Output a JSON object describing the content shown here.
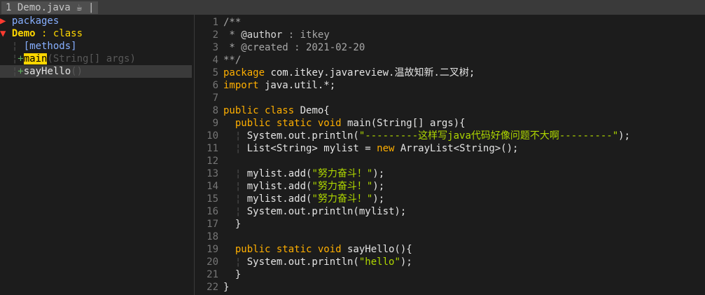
{
  "tabline": {
    "tab_label": "1 Demo.java ☕ |"
  },
  "tagbar": {
    "packages_label": "packages",
    "class_name": "Demo",
    "class_kind": " : class",
    "methods_group": "[methods]",
    "methods": [
      {
        "name": "main",
        "signature": "(String[] args)"
      },
      {
        "name": "sayHello",
        "signature": "()"
      }
    ]
  },
  "editor": {
    "lines": [
      {
        "n": "1",
        "tokens": [
          [
            "c-com",
            "/**"
          ]
        ]
      },
      {
        "n": "2",
        "tokens": [
          [
            "c-com",
            " * "
          ],
          [
            "c-ann",
            "@author"
          ],
          [
            "c-com",
            " : itkey"
          ]
        ]
      },
      {
        "n": "3",
        "tokens": [
          [
            "c-com",
            " * @created : 2021-02-20"
          ]
        ]
      },
      {
        "n": "4",
        "tokens": [
          [
            "c-com",
            "**/"
          ]
        ]
      },
      {
        "n": "5",
        "tokens": [
          [
            "c-kw",
            "package"
          ],
          [
            "c-txt",
            " com.itkey.javareview.温故知新.二叉树;"
          ]
        ]
      },
      {
        "n": "6",
        "tokens": [
          [
            "c-kw",
            "import"
          ],
          [
            "c-txt",
            " java.util.*;"
          ]
        ]
      },
      {
        "n": "7",
        "tokens": []
      },
      {
        "n": "8",
        "tokens": [
          [
            "c-kw",
            "public class"
          ],
          [
            "c-txt",
            " Demo{"
          ]
        ]
      },
      {
        "n": "9",
        "tokens": [
          [
            "c-txt",
            "  "
          ],
          [
            "c-kw",
            "public static void"
          ],
          [
            "c-txt",
            " main(String[] args){"
          ]
        ]
      },
      {
        "n": "10",
        "tokens": [
          [
            "vg",
            "  ¦ "
          ],
          [
            "c-txt",
            "System.out.println("
          ],
          [
            "c-str",
            "\"---------这样写java代码好像问题不大啊---------\""
          ],
          [
            "c-txt",
            ");"
          ]
        ]
      },
      {
        "n": "11",
        "tokens": [
          [
            "vg",
            "  ¦ "
          ],
          [
            "c-txt",
            "List<String> mylist = "
          ],
          [
            "c-kw",
            "new"
          ],
          [
            "c-txt",
            " ArrayList<String>();"
          ]
        ]
      },
      {
        "n": "12",
        "tokens": []
      },
      {
        "n": "13",
        "tokens": [
          [
            "vg",
            "  ¦ "
          ],
          [
            "c-txt",
            "mylist.add("
          ],
          [
            "c-str",
            "\"努力奋斗！\""
          ],
          [
            "c-txt",
            ");"
          ]
        ]
      },
      {
        "n": "14",
        "tokens": [
          [
            "vg",
            "  ¦ "
          ],
          [
            "c-txt",
            "mylist.add("
          ],
          [
            "c-str",
            "\"努力奋斗！\""
          ],
          [
            "c-txt",
            ");"
          ]
        ]
      },
      {
        "n": "15",
        "tokens": [
          [
            "vg",
            "  ¦ "
          ],
          [
            "c-txt",
            "mylist.add("
          ],
          [
            "c-str",
            "\"努力奋斗！\""
          ],
          [
            "c-txt",
            ");"
          ]
        ]
      },
      {
        "n": "16",
        "tokens": [
          [
            "vg",
            "  ¦ "
          ],
          [
            "c-txt",
            "System.out.println(mylist);"
          ]
        ]
      },
      {
        "n": "17",
        "tokens": [
          [
            "c-txt",
            "  }"
          ]
        ]
      },
      {
        "n": "18",
        "tokens": []
      },
      {
        "n": "19",
        "tokens": [
          [
            "c-txt",
            "  "
          ],
          [
            "c-kw",
            "public static void"
          ],
          [
            "c-txt",
            " sayHello(){"
          ]
        ]
      },
      {
        "n": "20",
        "tokens": [
          [
            "vg",
            "  ¦ "
          ],
          [
            "c-txt",
            "System.out.println("
          ],
          [
            "c-str",
            "\"hello\""
          ],
          [
            "c-txt",
            ");"
          ]
        ]
      },
      {
        "n": "21",
        "tokens": [
          [
            "c-txt",
            "  }"
          ]
        ]
      },
      {
        "n": "22",
        "tokens": [
          [
            "c-txt",
            "}"
          ]
        ]
      }
    ]
  },
  "colors": {
    "background": "#1c1c1c",
    "keyword": "#ffaf00",
    "string": "#afd700",
    "class_name": "#ffd700",
    "fold_marker": "#ff3b30",
    "line_number": "#767676"
  }
}
